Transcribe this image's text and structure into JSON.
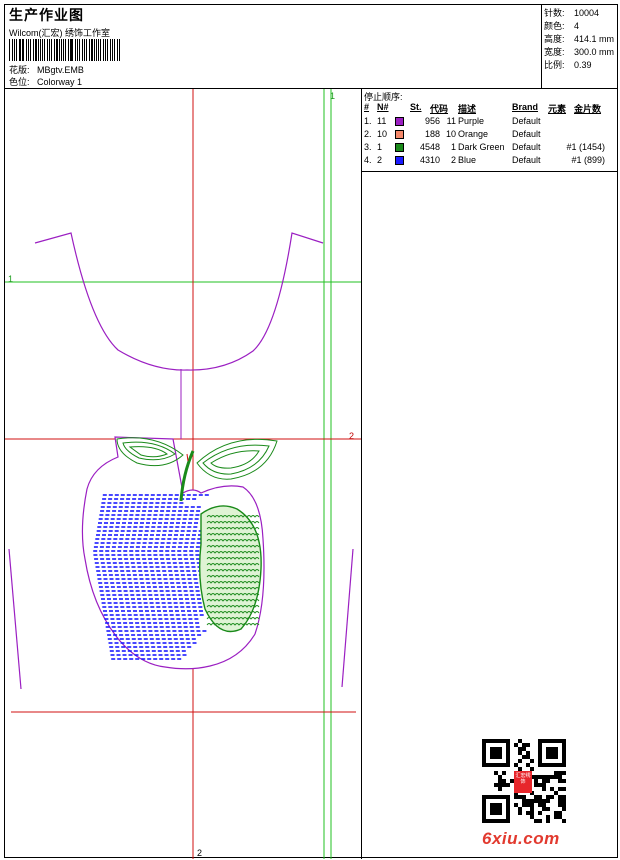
{
  "header": {
    "title": "生产作业图",
    "company": "Wilcom(汇宏) 绣饰工作室",
    "design_label": "花版:",
    "design_value": "MBgtv.EMB",
    "colorway_label": "色位:",
    "colorway_value": "Colorway 1"
  },
  "specs": [
    {
      "label": "针数:",
      "value": "10004"
    },
    {
      "label": "颜色:",
      "value": "4"
    },
    {
      "label": "高度:",
      "value": "414.1 mm"
    },
    {
      "label": "宽度:",
      "value": "300.0 mm"
    },
    {
      "label": "比例:",
      "value": "0.39"
    }
  ],
  "guides": {
    "green_v": "1",
    "green_h": "1",
    "red_h": "2",
    "red_v": "2"
  },
  "stop_sequence": {
    "title": "停止顺序:",
    "headers": {
      "idx": "#",
      "no": "N#",
      "st": "St.",
      "code": "代码",
      "desc": "描述",
      "brand": "Brand",
      "comp": "元素",
      "seq": "金片数"
    },
    "rows": [
      {
        "idx": "1.",
        "no": "11",
        "color": "#9b1fc2",
        "st": "956",
        "code": "11",
        "desc": "Purple",
        "brand": "Default",
        "seq": ""
      },
      {
        "idx": "2.",
        "no": "10",
        "color": "#f4886a",
        "st": "188",
        "code": "10",
        "desc": "Orange",
        "brand": "Default",
        "seq": ""
      },
      {
        "idx": "3.",
        "no": "1",
        "color": "#1a8a1a",
        "st": "4548",
        "code": "1",
        "desc": "Dark Green",
        "brand": "Default",
        "seq": "#1 (1454)"
      },
      {
        "idx": "4.",
        "no": "2",
        "color": "#1a1aff",
        "st": "4310",
        "code": "2",
        "desc": "Blue",
        "brand": "Default",
        "seq": "#1 (899)"
      }
    ]
  },
  "watermark": "6xiu.com",
  "seal_text": "汇宏绣饰",
  "colors": {
    "purple": "#9b1fc2",
    "green": "#1a8a1a",
    "blue": "#1a1aff",
    "guide_green": "#22c022",
    "guide_red": "#d01010"
  }
}
